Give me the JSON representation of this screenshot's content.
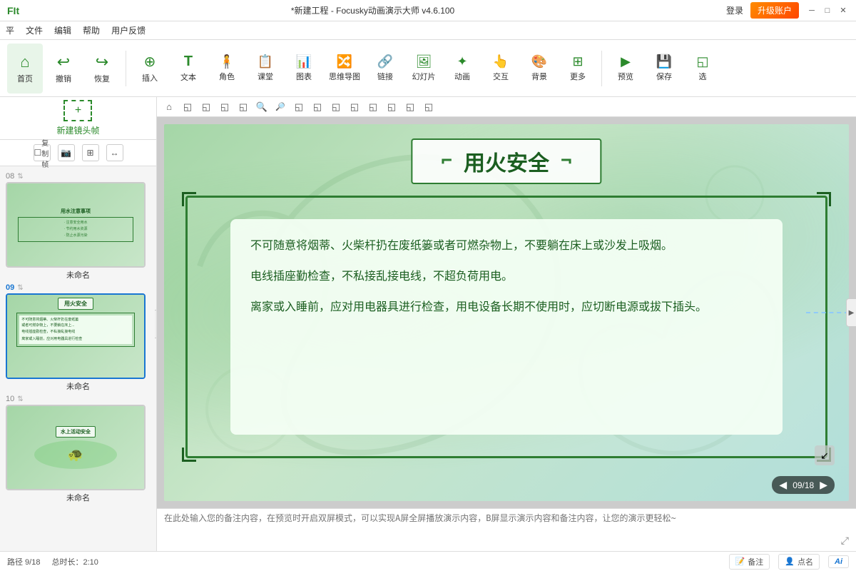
{
  "app": {
    "title": "*新建工程 - Focusky动画演示大师 v4.6.100",
    "logo": "FIt",
    "login_label": "登录",
    "upgrade_label": "升级账户"
  },
  "menu": {
    "items": [
      "平",
      "文件",
      "编辑",
      "帮助",
      "用户反馈"
    ]
  },
  "toolbar": {
    "groups": [
      {
        "id": "home",
        "icon": "⌂",
        "label": "首页"
      },
      {
        "id": "undo",
        "icon": "↩",
        "label": "撤销"
      },
      {
        "id": "redo",
        "icon": "↪",
        "label": "恢复"
      },
      {
        "id": "insert",
        "icon": "⊕",
        "label": "插入"
      },
      {
        "id": "text",
        "icon": "T",
        "label": "文本"
      },
      {
        "id": "role",
        "icon": "👤",
        "label": "角色"
      },
      {
        "id": "class",
        "icon": "📚",
        "label": "课堂"
      },
      {
        "id": "chart",
        "icon": "📊",
        "label": "图表"
      },
      {
        "id": "mindmap",
        "icon": "🔀",
        "label": "思维导图"
      },
      {
        "id": "link",
        "icon": "🔗",
        "label": "链接"
      },
      {
        "id": "slide",
        "icon": "🖼",
        "label": "幻灯片"
      },
      {
        "id": "animate",
        "icon": "✨",
        "label": "动画"
      },
      {
        "id": "interact",
        "icon": "👆",
        "label": "交互"
      },
      {
        "id": "bg",
        "icon": "🎨",
        "label": "背景"
      },
      {
        "id": "more",
        "icon": "▦",
        "label": "更多"
      },
      {
        "id": "preview",
        "icon": "▶",
        "label": "预览"
      },
      {
        "id": "save",
        "icon": "💾",
        "label": "保存"
      },
      {
        "id": "select",
        "icon": "◱",
        "label": "选"
      }
    ]
  },
  "slides_panel": {
    "new_frame_label": "新建镜头帧",
    "copy_btn": "复制帧",
    "tools": [
      "📷",
      "⊞",
      "↔"
    ],
    "slides": [
      {
        "number": "08",
        "label": "未命名",
        "active": false,
        "title": "用水注意事项"
      },
      {
        "number": "09",
        "label": "未命名",
        "active": true,
        "title": "用火安全"
      },
      {
        "number": "10",
        "label": "未命名",
        "active": false,
        "title": "水上活动安全"
      }
    ]
  },
  "canvas": {
    "toolbar_icons": [
      "⌂",
      "◱",
      "◱",
      "◱",
      "◱",
      "◱",
      "🔍+",
      "🔍-",
      "◱",
      "◱",
      "◱",
      "◱",
      "◱",
      "◱",
      "◱",
      "◱"
    ],
    "slide_title": "用火安全",
    "content_paragraphs": [
      "不可随意将烟蒂、火柴杆扔在废纸篓或者可燃杂物上，不要躺在床上或沙发上吸烟。",
      "电线插座勤检查，不私接乱接电线，不超负荷用电。",
      "离家或入睡前，应对用电器具进行检查，用电设备长期不使用时，应切断电源或拔下插头。"
    ],
    "page_current": "09",
    "page_total": "18",
    "page_label": "09/18"
  },
  "notes": {
    "placeholder": "在此处输入您的备注内容，在预览时开启双屏模式，可以实现A屏全屏播放演示内容，B屏显示演示内容和备注内容，让您的演示更轻松~"
  },
  "statusbar": {
    "path": "路径 9/18",
    "duration": "总时长：2:10",
    "note_btn": "备注",
    "point_btn": "点名",
    "ai_label": "Ai"
  }
}
